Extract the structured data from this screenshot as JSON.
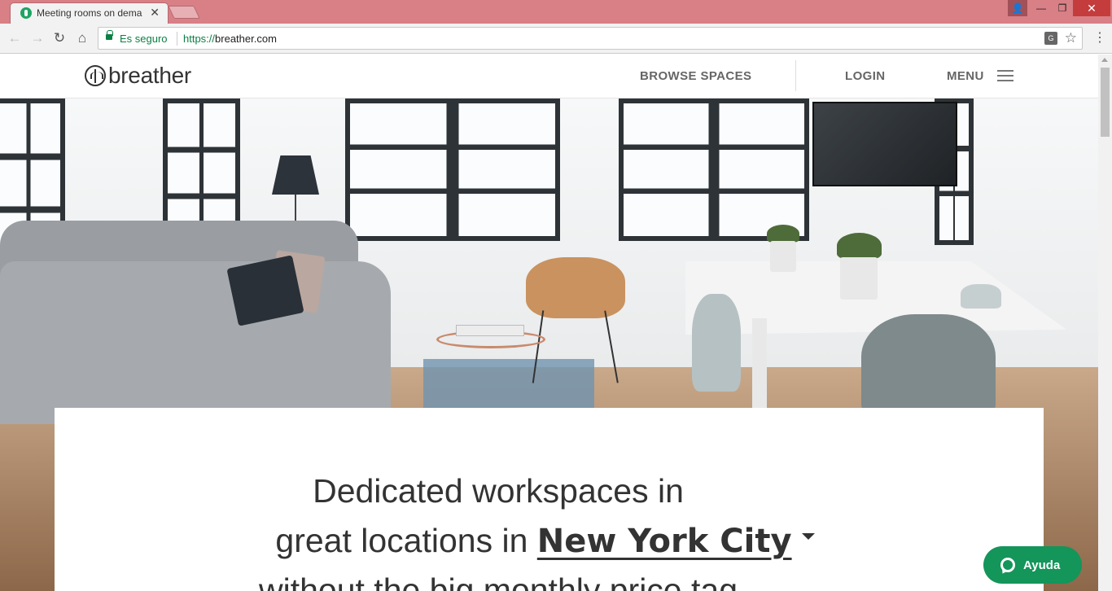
{
  "browser": {
    "tab_title": "Meeting rooms on dema",
    "tab_close": "✕",
    "secure_label": "Es seguro",
    "url_scheme": "https://",
    "url_host": "breather.com",
    "translate_glyph": "G",
    "bookmark_glyph": "☆",
    "menu_glyph": "⋮",
    "window_controls": {
      "user": "👤",
      "minimize": "—",
      "maximize": "❐",
      "close": "✕"
    },
    "nav": {
      "back": "←",
      "forward": "→",
      "reload": "↻",
      "home": "⌂"
    }
  },
  "site": {
    "logo_text": "breather",
    "nav": {
      "browse": "BROWSE SPACES",
      "login": "LOGIN",
      "menu": "MENU"
    }
  },
  "hero": {
    "line1": "Dedicated workspaces in",
    "line2_prefix": "great locations in ",
    "city": "New York City",
    "line3": "without the big monthly price tag"
  },
  "help_widget": {
    "label": "Ayuda"
  },
  "colors": {
    "tab_strip": "#d97f86",
    "secure_green": "#0b8043",
    "help_green": "#14955a"
  }
}
